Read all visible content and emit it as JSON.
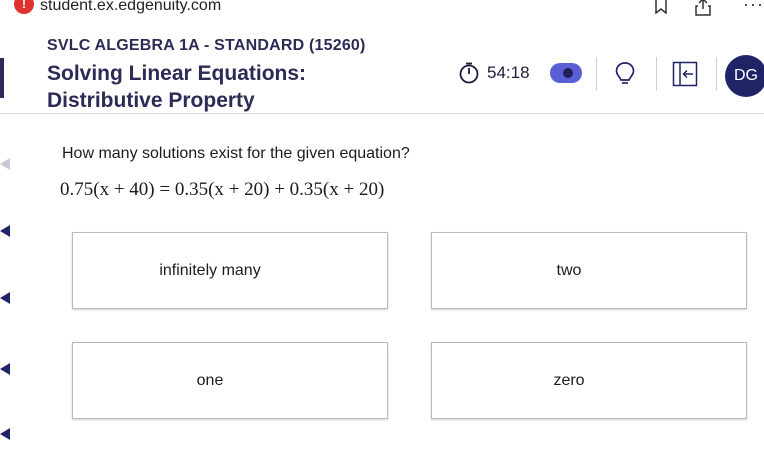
{
  "browser": {
    "url": "student.ex.edgenuity.com",
    "alert_glyph": "!",
    "more_glyph": "···"
  },
  "header": {
    "course": "SVLC ALGEBRA 1A - STANDARD (15260)",
    "title_line1": "Solving Linear Equations:",
    "title_line2": "Distributive Property",
    "timer": "54:18",
    "avatar_initials": "DG",
    "icons": [
      "timer-icon",
      "toggle-switch",
      "lightbulb-icon",
      "collapse-panel-icon",
      "avatar"
    ]
  },
  "question": {
    "prompt": "How many solutions exist for the given equation?",
    "equation": "0.75(x + 40) = 0.35(x + 20) + 0.35(x + 20)"
  },
  "choices": [
    {
      "label": "infinitely many"
    },
    {
      "label": "two"
    },
    {
      "label": "one"
    },
    {
      "label": "zero"
    }
  ],
  "colors": {
    "brand_navy": "#1f2466",
    "heading": "#2b2b55",
    "toggle": "#5b5fd6",
    "alert": "#e03131"
  }
}
